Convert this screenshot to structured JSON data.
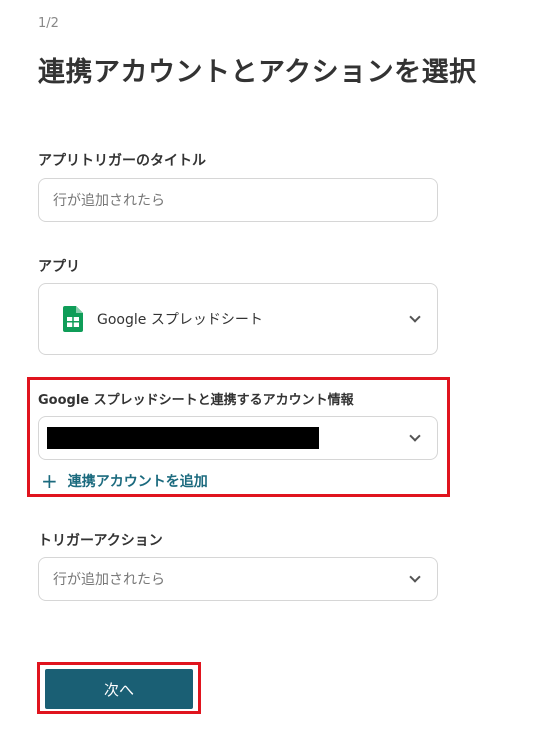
{
  "step_indicator": "1/2",
  "page_title": "連携アカウントとアクションを選択",
  "trigger_title": {
    "label": "アプリトリガーのタイトル",
    "value": "行が追加されたら"
  },
  "app": {
    "label": "アプリ",
    "value": "Google スプレッドシート",
    "icon": "google-sheets-icon"
  },
  "account": {
    "label": "Google スプレッドシートと連携するアカウント情報",
    "value_redacted": true,
    "add_link_label": "連携アカウントを追加"
  },
  "trigger_action": {
    "label": "トリガーアクション",
    "value": "行が追加されたら"
  },
  "next_button": "次へ",
  "colors": {
    "primary": "#1a5f74",
    "link": "#1b6a7e",
    "highlight": "#e0141e",
    "sheets_green": "#0f9d58"
  }
}
